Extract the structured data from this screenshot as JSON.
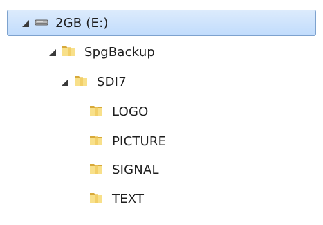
{
  "tree": {
    "drive": {
      "label": "2GB (E:)",
      "icon": "drive-icon",
      "expanded": true,
      "selected": true
    },
    "items": [
      {
        "label": "SpgBackup",
        "icon": "folder-icon",
        "expanded": true
      },
      {
        "label": "SDI7",
        "icon": "folder-icon",
        "expanded": true
      },
      {
        "label": "LOGO",
        "icon": "folder-icon"
      },
      {
        "label": "PICTURE",
        "icon": "folder-icon"
      },
      {
        "label": "SIGNAL",
        "icon": "folder-icon"
      },
      {
        "label": "TEXT",
        "icon": "folder-icon"
      }
    ]
  },
  "colors": {
    "selection_border": "#7da2ce",
    "selection_fill_top": "#dcebfc",
    "selection_fill_bottom": "#c1dcfc",
    "folder_light": "#f8e08a",
    "folder_dark": "#d7a93a"
  }
}
